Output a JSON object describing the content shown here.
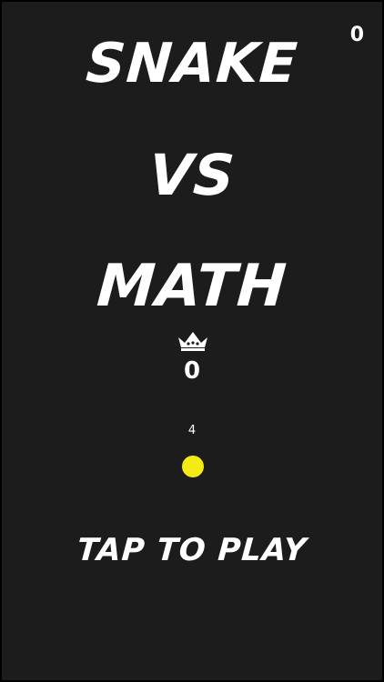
{
  "title": {
    "line1": "SNAKE",
    "line2": "VS",
    "line3": "MATH"
  },
  "current_score": "0",
  "best_score": {
    "icon": "crown-icon",
    "value": "0"
  },
  "snake": {
    "length": "4",
    "color": "#f5ea14"
  },
  "prompt": "TAP TO PLAY",
  "colors": {
    "background": "#1c1c1c",
    "text": "#ffffff",
    "snake": "#f5ea14"
  }
}
